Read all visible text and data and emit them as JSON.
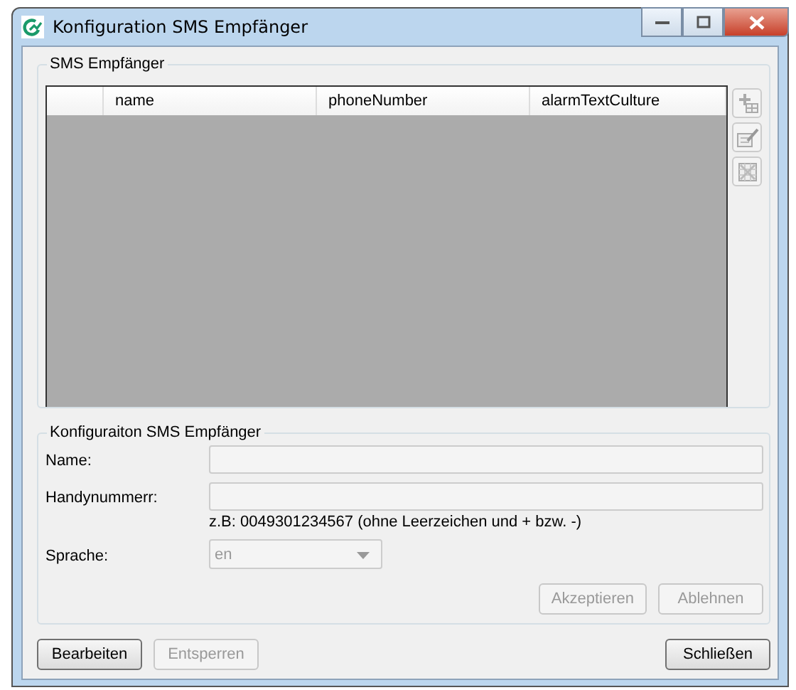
{
  "window": {
    "title": "Konfiguration SMS Empfänger"
  },
  "recipients": {
    "title": "SMS Empfänger",
    "columns": [
      "name",
      "phoneNumber",
      "alarmTextCulture"
    ],
    "side_buttons": [
      {
        "kind": "add",
        "disabled": true
      },
      {
        "kind": "edit",
        "disabled": true
      },
      {
        "kind": "delete",
        "disabled": true
      }
    ]
  },
  "config": {
    "title": "Konfiguraiton SMS Empfänger",
    "fields": [
      {
        "label": "Name:",
        "kind": "text",
        "disabled": true
      },
      {
        "label": "Handynummerr:",
        "kind": "text",
        "disabled": true,
        "hint": "z.B: 0049301234567 (ohne Leerzeichen und + bzw. -)"
      },
      {
        "label": "Sprache:",
        "kind": "select",
        "value": "en",
        "disabled": true
      }
    ],
    "buttons": [
      {
        "label": "Akzeptieren",
        "disabled": true
      },
      {
        "label": "Ablehnen",
        "disabled": true
      }
    ]
  },
  "footer_left": [
    {
      "label": "Bearbeiten",
      "disabled": false
    },
    {
      "label": "Entsperren",
      "disabled": true
    }
  ],
  "footer_right": [
    {
      "label": "Schließen",
      "disabled": false
    }
  ]
}
